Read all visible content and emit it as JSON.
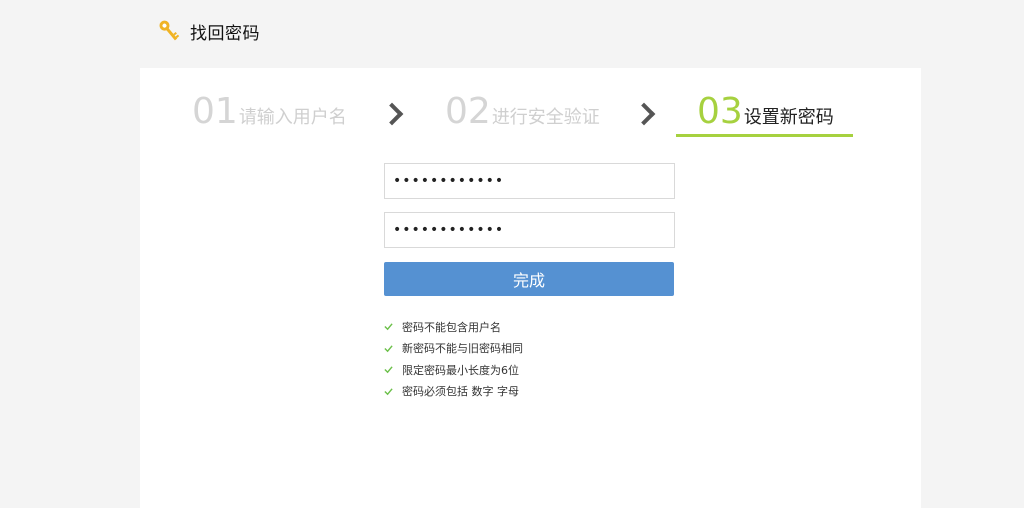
{
  "header": {
    "title": "找回密码",
    "icon": "key-icon"
  },
  "steps": [
    {
      "num": "01",
      "label": "请输入用户名",
      "state": "done"
    },
    {
      "num": "02",
      "label": "进行安全验证",
      "state": "done"
    },
    {
      "num": "03",
      "label": "设置新密码",
      "state": "active"
    }
  ],
  "form": {
    "password": "••••••••••••",
    "confirm_password": "••••••••••••",
    "submit_label": "完成"
  },
  "rules": [
    "密码不能包含用户名",
    "新密码不能与旧密码相同",
    "限定密码最小长度为6位",
    "密码必须包括 数字 字母"
  ],
  "colors": {
    "accent_green": "#a6d13f",
    "button_blue": "#5591d2",
    "check_green": "#6cc04a",
    "key_yellow": "#f0b323"
  }
}
